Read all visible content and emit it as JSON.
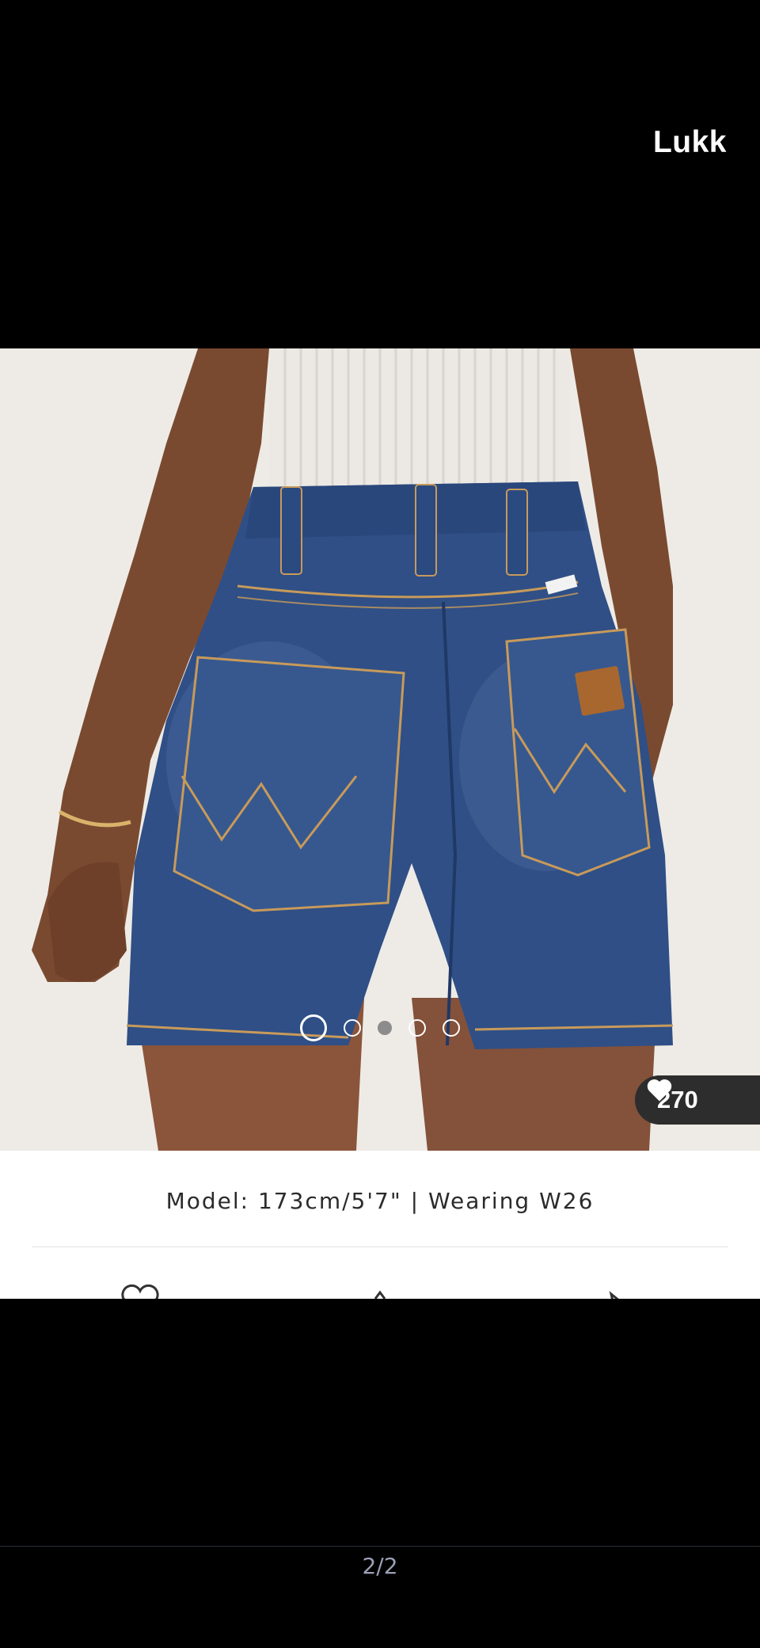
{
  "viewer": {
    "close_label": "Lukk",
    "page_indicator": "2/2"
  },
  "product": {
    "likes": "270",
    "model_caption": "Model: 173cm/5'7\" | Wearing W26",
    "carousel_total": 5,
    "carousel_active": 1
  },
  "icons": {
    "like": "heart-icon",
    "save": "heart-outline-icon",
    "share": "share-icon"
  },
  "colors": {
    "background": "#000000",
    "pill": "#2d2d2d",
    "denim": "#2f4f86"
  }
}
